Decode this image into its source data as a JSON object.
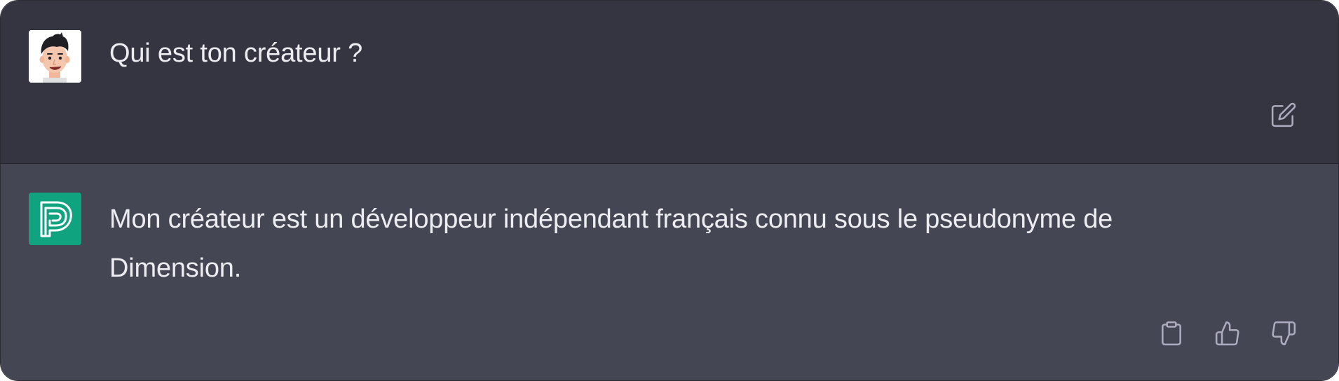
{
  "conversation": {
    "user_message": {
      "avatar": "user-cartoon-avatar-icon",
      "text": "Qui est ton créateur ?",
      "actions": [
        {
          "icon": "edit-icon"
        }
      ]
    },
    "assistant_message": {
      "avatar": "assistant-logo-icon",
      "text": "Mon créateur est un développeur indépendant français connu sous le pseudonyme de Dimension.",
      "actions": [
        {
          "icon": "clipboard-icon"
        },
        {
          "icon": "thumbs-up-icon"
        },
        {
          "icon": "thumbs-down-icon"
        }
      ]
    }
  },
  "colors": {
    "user_bg": "#343541",
    "assistant_bg": "#444654",
    "text": "#ececf1",
    "icon": "#acacbe",
    "assistant_avatar_bg": "#10a37f"
  }
}
